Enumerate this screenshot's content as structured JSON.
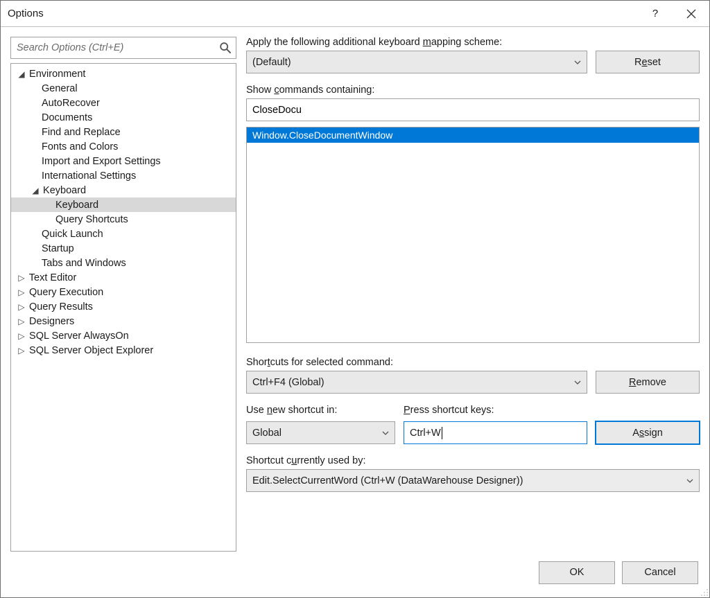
{
  "titlebar": {
    "title": "Options",
    "help_label": "?"
  },
  "search": {
    "placeholder": "Search Options (Ctrl+E)"
  },
  "tree": {
    "items": [
      {
        "label": "Environment",
        "level": 0,
        "expanded": true
      },
      {
        "label": "General",
        "level": 1
      },
      {
        "label": "AutoRecover",
        "level": 1
      },
      {
        "label": "Documents",
        "level": 1
      },
      {
        "label": "Find and Replace",
        "level": 1
      },
      {
        "label": "Fonts and Colors",
        "level": 1
      },
      {
        "label": "Import and Export Settings",
        "level": 1
      },
      {
        "label": "International Settings",
        "level": 1
      },
      {
        "label": "Keyboard",
        "level": 1,
        "expanded": true
      },
      {
        "label": "Keyboard",
        "level": 2,
        "selected": true
      },
      {
        "label": "Query Shortcuts",
        "level": 2
      },
      {
        "label": "Quick Launch",
        "level": 1
      },
      {
        "label": "Startup",
        "level": 1
      },
      {
        "label": "Tabs and Windows",
        "level": 1
      },
      {
        "label": "Text Editor",
        "level": 0,
        "expanded": false
      },
      {
        "label": "Query Execution",
        "level": 0,
        "expanded": false
      },
      {
        "label": "Query Results",
        "level": 0,
        "expanded": false
      },
      {
        "label": "Designers",
        "level": 0,
        "expanded": false
      },
      {
        "label": "SQL Server AlwaysOn",
        "level": 0,
        "expanded": false
      },
      {
        "label": "SQL Server Object Explorer",
        "level": 0,
        "expanded": false
      }
    ]
  },
  "mapping": {
    "label_pre": "Apply the following additional keyboard ",
    "label_u": "m",
    "label_post": "apping scheme:",
    "value": "(Default)",
    "reset_pre": "R",
    "reset_u": "e",
    "reset_post": "set"
  },
  "showcmds": {
    "label_pre": "Show ",
    "label_u": "c",
    "label_post": "ommands containing:",
    "value": "CloseDocu"
  },
  "commands": {
    "items": [
      {
        "label": "Window.CloseDocumentWindow",
        "selected": true
      }
    ]
  },
  "shortcuts": {
    "label_pre": "Shor",
    "label_u": "t",
    "label_post": "cuts for selected command:",
    "value": "Ctrl+F4 (Global)",
    "remove_u": "R",
    "remove_post": "emove"
  },
  "newshortcut": {
    "use_label_pre": "Use ",
    "use_label_u": "n",
    "use_label_post": "ew shortcut in:",
    "use_value": "Global",
    "press_u": "P",
    "press_post": "ress shortcut keys:",
    "press_value": "Ctrl+W",
    "assign_pre": "A",
    "assign_u": "s",
    "assign_post": "sign"
  },
  "usedby": {
    "label_pre": "Shortcut c",
    "label_u": "u",
    "label_post": "rrently used by:",
    "value": "Edit.SelectCurrentWord (Ctrl+W (DataWarehouse Designer))"
  },
  "footer": {
    "ok": "OK",
    "cancel": "Cancel"
  }
}
